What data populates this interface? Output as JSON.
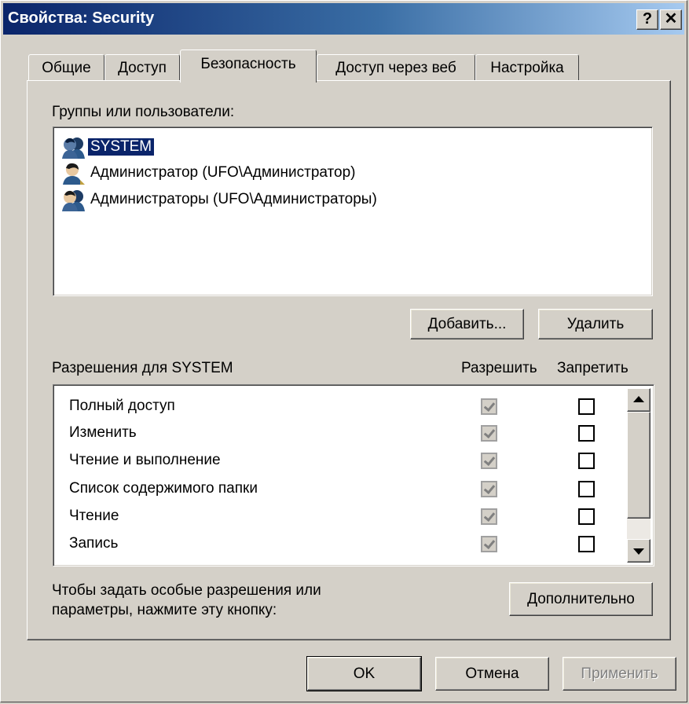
{
  "window": {
    "title": "Свойства: Security",
    "help_glyph": "?",
    "close_glyph": "✕"
  },
  "tabs": [
    {
      "label": "Общие"
    },
    {
      "label": "Доступ"
    },
    {
      "label": "Безопасность"
    },
    {
      "label": "Доступ через веб"
    },
    {
      "label": "Настройка"
    }
  ],
  "groups": {
    "label": "Группы или пользователи:",
    "items": [
      {
        "name": "SYSTEM",
        "icon": "group-icon",
        "selected": true
      },
      {
        "name": "Администратор (UFO\\Администратор)",
        "icon": "user-icon",
        "selected": false
      },
      {
        "name": "Администраторы (UFO\\Администраторы)",
        "icon": "group-icon",
        "selected": false
      }
    ]
  },
  "buttons": {
    "add": "Добавить...",
    "remove": "Удалить",
    "advanced": "Дополнительно",
    "ok": "OK",
    "cancel": "Отмена",
    "apply": "Применить"
  },
  "permissions": {
    "label": "Разрешения для SYSTEM",
    "allow_header": "Разрешить",
    "deny_header": "Запретить",
    "rows": [
      {
        "name": "Полный доступ",
        "allow": true,
        "deny": false
      },
      {
        "name": "Изменить",
        "allow": true,
        "deny": false
      },
      {
        "name": "Чтение и выполнение",
        "allow": true,
        "deny": false
      },
      {
        "name": "Список содержимого папки",
        "allow": true,
        "deny": false
      },
      {
        "name": "Чтение",
        "allow": true,
        "deny": false
      },
      {
        "name": "Запись",
        "allow": true,
        "deny": false
      }
    ]
  },
  "advanced_hint": {
    "line1": "Чтобы задать особые разрешения или",
    "line2": "параметры, нажмите эту кнопку:"
  },
  "colors": {
    "face": "#d4d0c8",
    "title_start": "#0a246a",
    "title_end": "#a6caf0",
    "selection": "#0a246a"
  }
}
